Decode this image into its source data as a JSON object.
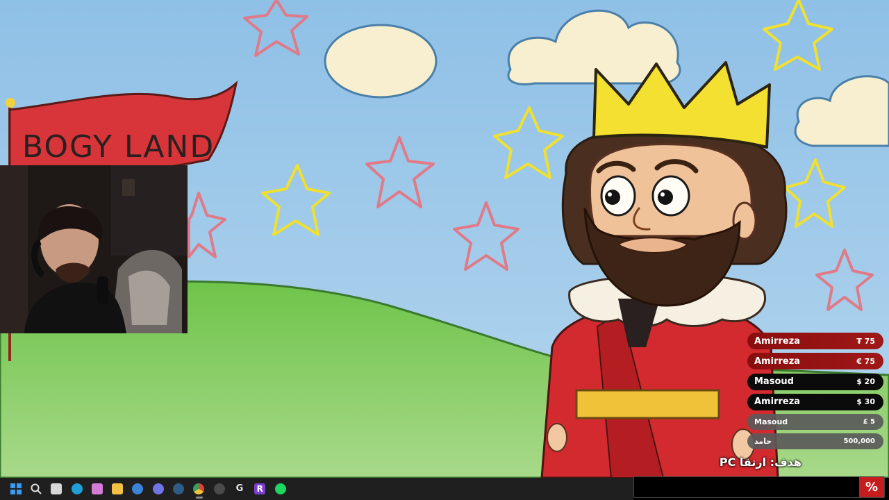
{
  "scene": {
    "banner_text": "BOGY LAND"
  },
  "donations": [
    {
      "name": "Amirreza",
      "amount": "₮ 75",
      "style": "red"
    },
    {
      "name": "Amirreza",
      "amount": "€ 75",
      "style": "red"
    },
    {
      "name": "Masoud",
      "amount": "$ 20",
      "style": "black"
    },
    {
      "name": "Amirreza",
      "amount": "$ 30",
      "style": "black"
    },
    {
      "name": "Masoud",
      "amount": "£ 5",
      "style": "gray"
    },
    {
      "name": "حامد",
      "amount": "500,000",
      "style": "gray"
    }
  ],
  "goal": {
    "label": "هدف: ارتقا PC",
    "progress_symbol": "%",
    "progress_fraction": 0.0
  },
  "taskbar": {
    "items": [
      {
        "name": "start-button",
        "icon": "windows-logo-icon",
        "color": "#3a9bf0"
      },
      {
        "name": "search-button",
        "icon": "search-icon",
        "color": "#e0e0e0"
      },
      {
        "name": "task-view-button",
        "icon": "task-view-icon",
        "color": "#d8d8d8"
      },
      {
        "name": "edge-button",
        "icon": "edge-icon",
        "color": "#1fa0d8"
      },
      {
        "name": "copilot-button",
        "icon": "copilot-icon",
        "color": "#d37bd6"
      },
      {
        "name": "file-explorer-button",
        "icon": "folder-icon",
        "color": "#f2c144"
      },
      {
        "name": "vpn-app-button",
        "icon": "compass-icon",
        "color": "#3b83d6"
      },
      {
        "name": "discord-button",
        "icon": "discord-icon",
        "color": "#6f75e6"
      },
      {
        "name": "steam-button",
        "icon": "steam-icon",
        "color": "#2d5d87"
      },
      {
        "name": "chrome-button",
        "icon": "chrome-icon",
        "color": "#e34133",
        "active": true
      },
      {
        "name": "obs-button",
        "icon": "obs-icon",
        "color": "#4a4a4a"
      },
      {
        "name": "logitech-button",
        "icon": "logitech-g-icon",
        "color": "#2b2b2b"
      },
      {
        "name": "r-app-button",
        "icon": "r-icon",
        "color": "#7a3fd0"
      },
      {
        "name": "spotify-button",
        "icon": "spotify-icon",
        "color": "#1ed760"
      }
    ]
  }
}
